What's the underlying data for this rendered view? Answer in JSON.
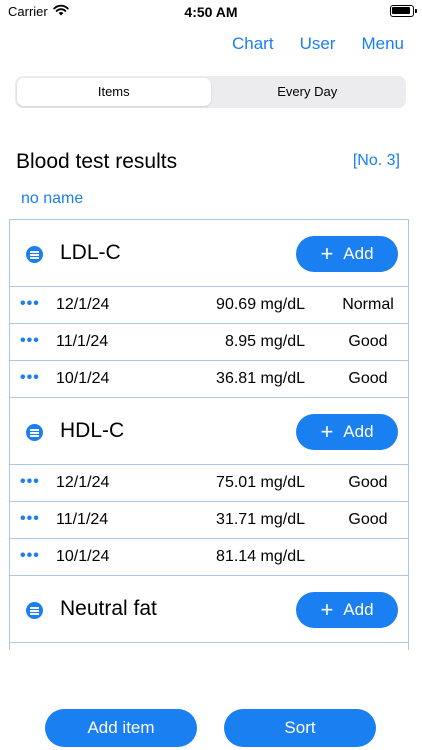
{
  "status_bar": {
    "carrier": "Carrier",
    "time": "4:50 AM"
  },
  "nav": {
    "chart": "Chart",
    "user": "User",
    "menu": "Menu"
  },
  "tabs": [
    {
      "label": "Items",
      "active": true
    },
    {
      "label": "Every Day",
      "active": false
    }
  ],
  "header": {
    "title": "Blood test results",
    "count": "[No. 3]",
    "name": "no name"
  },
  "groups": [
    {
      "title": "LDL-C",
      "add_label": "Add",
      "rows": [
        {
          "date": "12/1/24",
          "value": "90.69 mg/dL",
          "status": "Normal"
        },
        {
          "date": "11/1/24",
          "value": "8.95 mg/dL",
          "status": "Good"
        },
        {
          "date": "10/1/24",
          "value": "36.81 mg/dL",
          "status": "Good"
        }
      ]
    },
    {
      "title": "HDL-C",
      "add_label": "Add",
      "rows": [
        {
          "date": "12/1/24",
          "value": "75.01 mg/dL",
          "status": "Good"
        },
        {
          "date": "11/1/24",
          "value": "31.71 mg/dL",
          "status": "Good"
        },
        {
          "date": "10/1/24",
          "value": "81.14 mg/dL",
          "status": ""
        }
      ]
    },
    {
      "title": "Neutral fat",
      "add_label": "Add",
      "rows": []
    }
  ],
  "more_glyph": "•••",
  "plus_glyph": "+",
  "bottom": {
    "add_item": "Add item",
    "sort": "Sort"
  },
  "colors": {
    "accent": "#1a7ff0",
    "divider": "#a9c8ea",
    "segment_bg": "#ececee"
  }
}
